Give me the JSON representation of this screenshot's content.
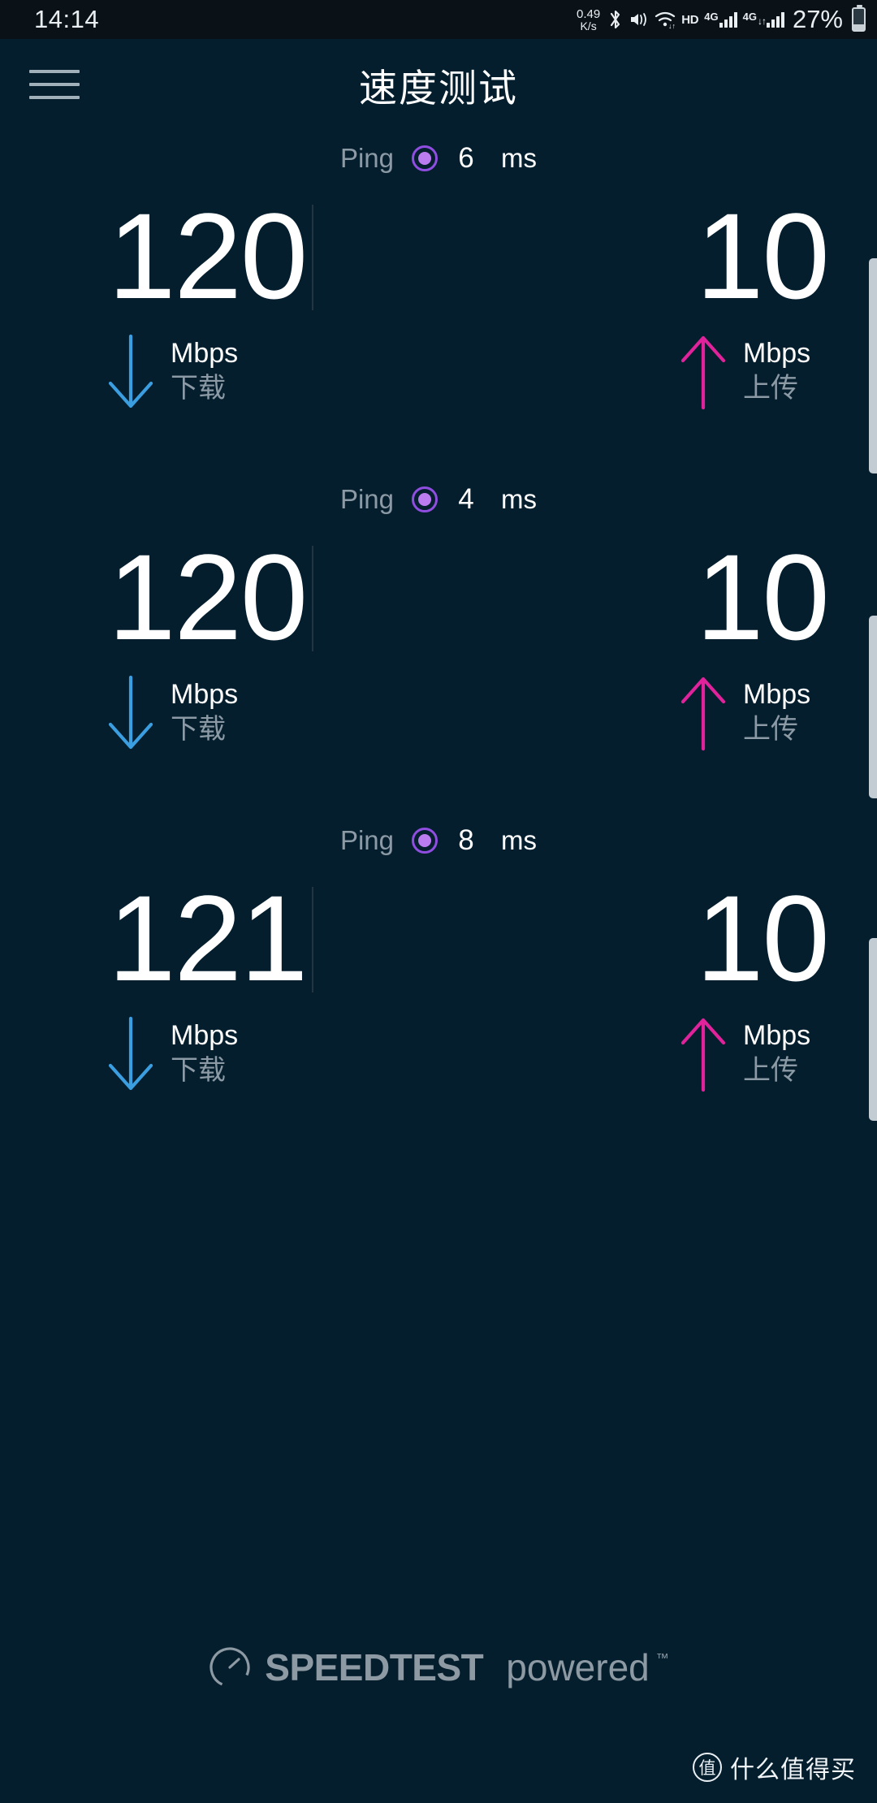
{
  "status_bar": {
    "clock": "14:14",
    "net_rate_value": "0.49",
    "net_rate_unit": "K/s",
    "hd_label": "HD",
    "sim1_label": "4G",
    "sim2_label": "4G",
    "battery_percent": "27%",
    "icons": [
      "bluetooth-icon",
      "mute-vibrate-icon",
      "wifi-icon",
      "hd-icon",
      "signal-bars-icon",
      "battery-icon"
    ]
  },
  "header": {
    "title": "速度测试",
    "menu_icon": "hamburger-menu-icon"
  },
  "labels": {
    "ping": "Ping",
    "ms": "ms",
    "mbps": "Mbps",
    "download": "下载",
    "upload": "上传"
  },
  "colors": {
    "background": "#041e2e",
    "download_arrow": "#3a9ee0",
    "upload_arrow": "#e0229b",
    "ping_dot": "#bb7cf0",
    "ping_ring": "#8f4ee0",
    "muted_text": "#8c9aa5"
  },
  "results": [
    {
      "ping": "6",
      "download": "120",
      "upload": "10"
    },
    {
      "ping": "4",
      "download": "120",
      "upload": "10"
    },
    {
      "ping": "8",
      "download": "121",
      "upload": "10"
    }
  ],
  "footer": {
    "brand_bold": "SPEEDTEST",
    "brand_light": "powered",
    "trademark": "™",
    "gauge_icon": "speedometer-icon"
  },
  "watermark": {
    "badge": "值",
    "text": "什么值得买"
  }
}
